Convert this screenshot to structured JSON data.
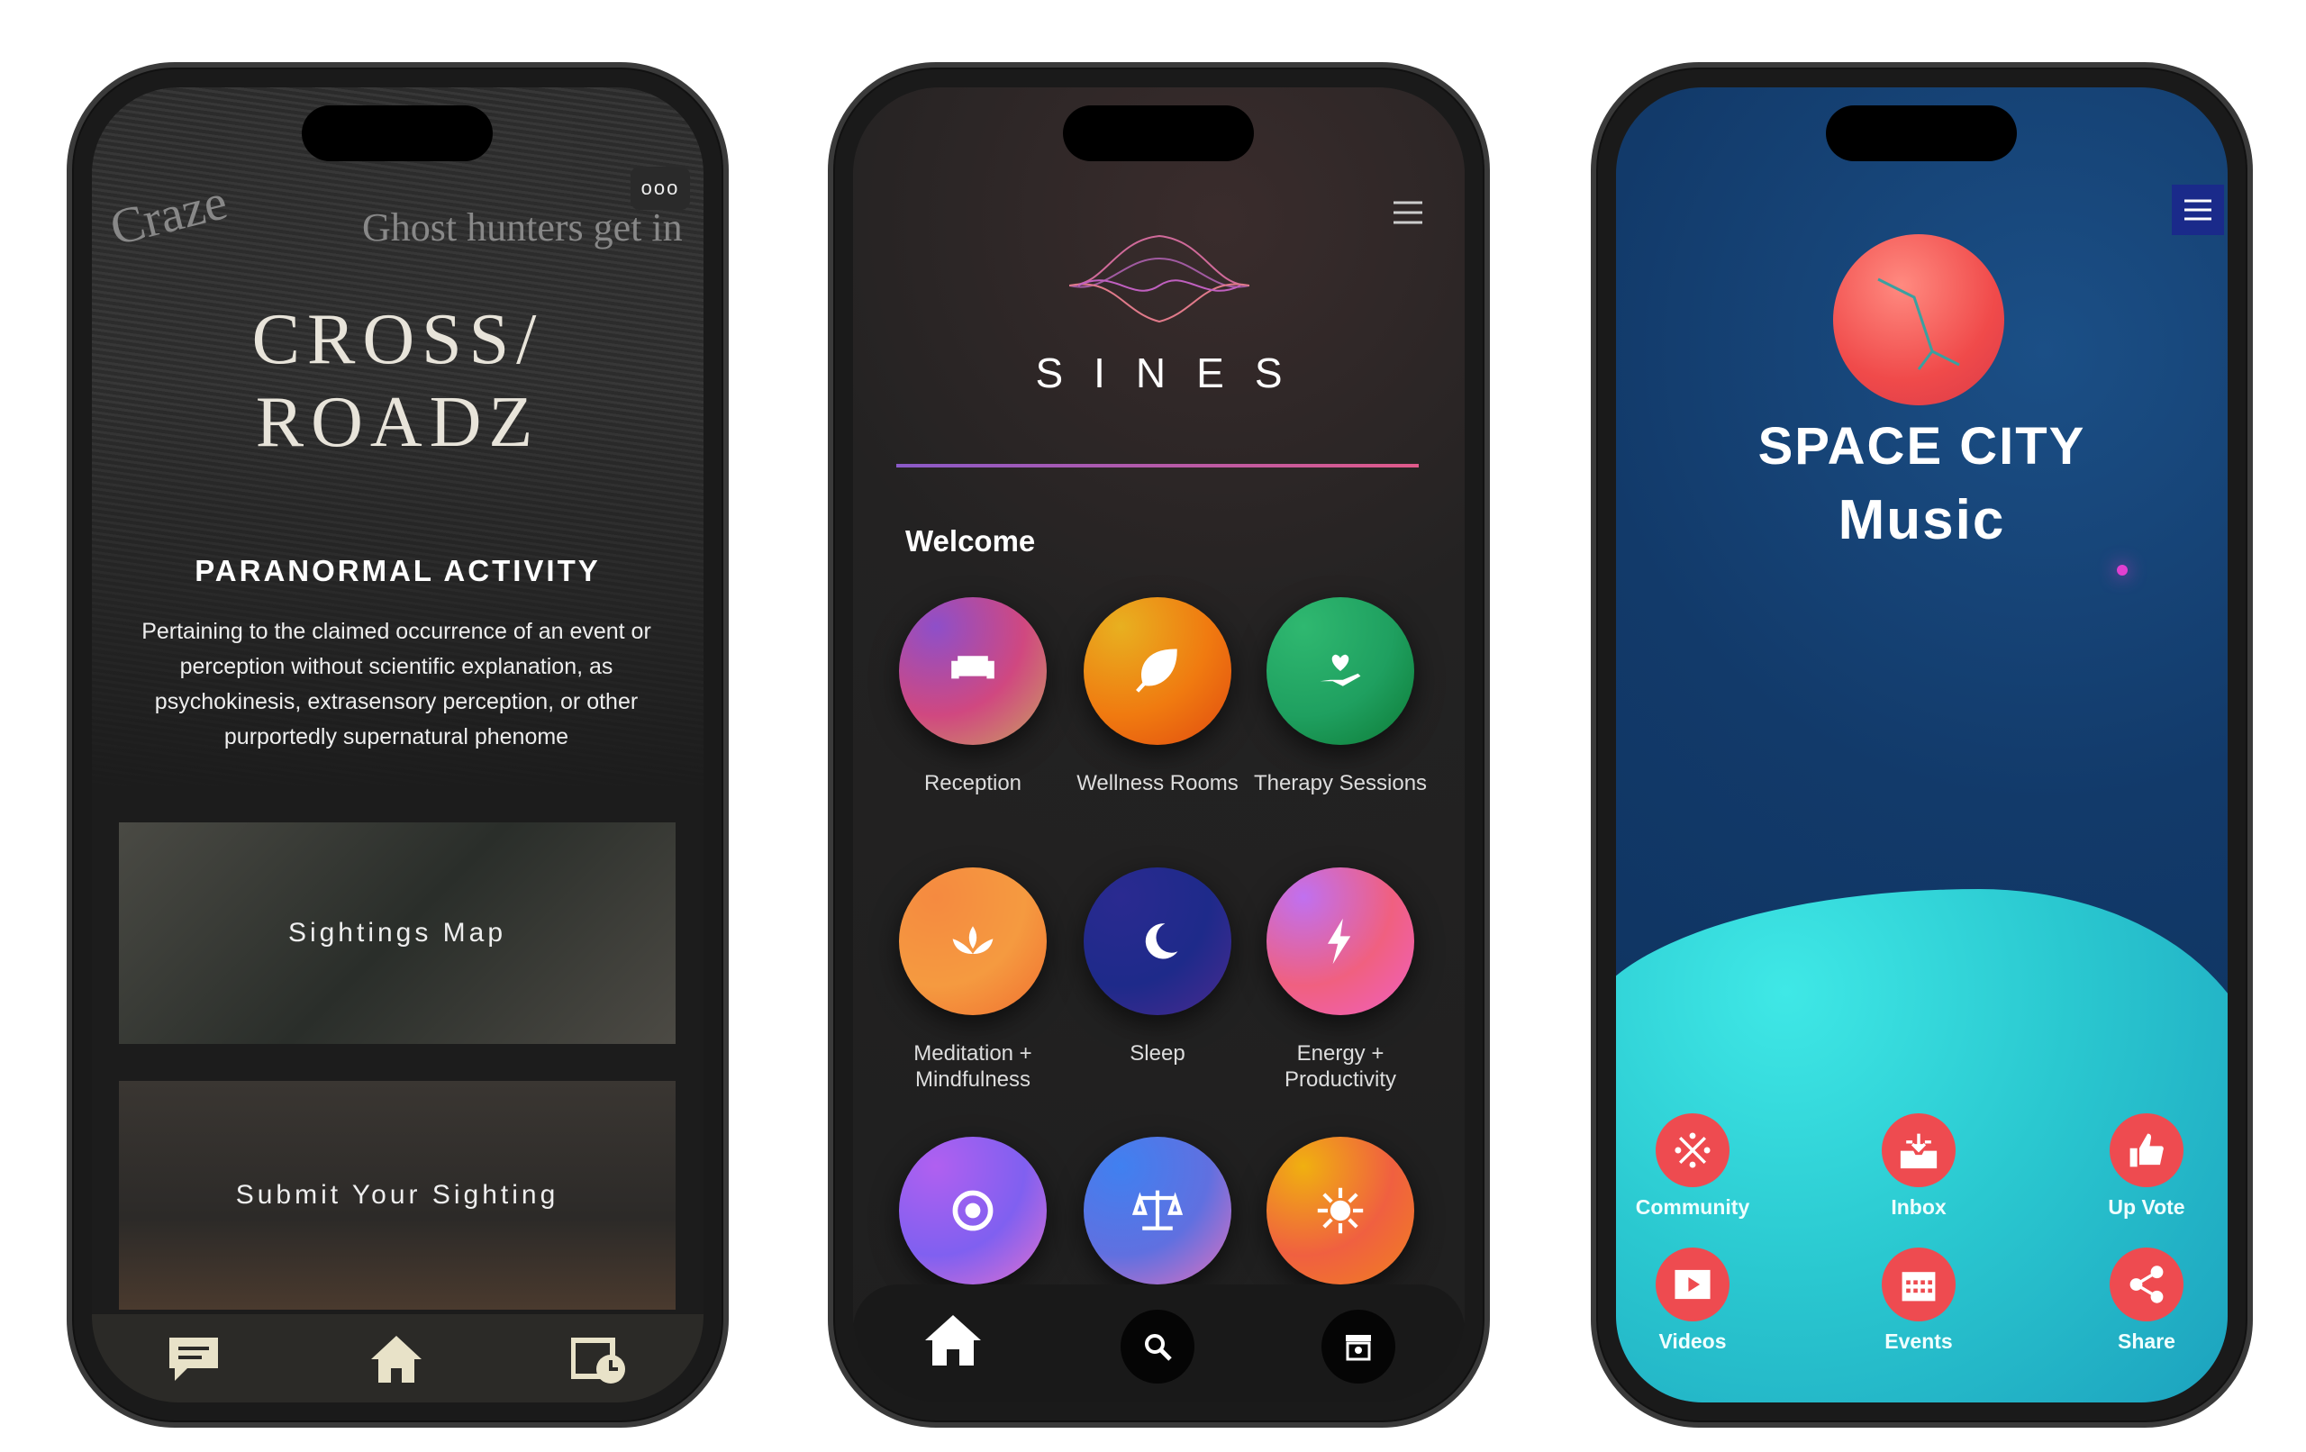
{
  "phones": [
    {
      "app": "crossroadz",
      "title_line1": "CROSS/",
      "title_line2": "ROADZ",
      "more_icon": "more-dots-icon",
      "newspaper_headlines": [
        "Craze",
        "Ghost hunters get in"
      ],
      "heading": "PARANORMAL ACTIVITY",
      "description": "Pertaining to the claimed occurrence of an event or perception without scientific explanation, as psychokinesis, extrasensory perception, or other purportedly  supernatural phenome",
      "cards": [
        {
          "label": "Sightings Map"
        },
        {
          "label": "Submit Your Sighting"
        }
      ],
      "nav": [
        "chat-icon",
        "home-icon",
        "calendar-clock-icon"
      ]
    },
    {
      "app": "sines",
      "brand": "SINES",
      "welcome": "Welcome",
      "menu_icon": "hamburger-icon",
      "tiles": [
        {
          "label": "Reception",
          "icon": "sofa-icon",
          "colors": [
            "#8e4fc9",
            "#c9a060",
            "#d04880"
          ]
        },
        {
          "label": "Wellness Rooms",
          "icon": "leaf-icon",
          "colors": [
            "#e8b020",
            "#e04a10",
            "#f07a10"
          ]
        },
        {
          "label": "Therapy Sessions",
          "icon": "heart-hand-icon",
          "colors": [
            "#2fb870",
            "#0d7a35",
            "#1fa060"
          ]
        },
        {
          "label": "Meditation + Mindfulness",
          "icon": "lotus-icon",
          "colors": [
            "#f58a40",
            "#f07030",
            "#f59a40"
          ]
        },
        {
          "label": "Sleep",
          "icon": "moon-icon",
          "colors": [
            "#2a2a90",
            "#4a2a90",
            "#1e2a8a"
          ]
        },
        {
          "label": "Energy + Productivity",
          "icon": "lightning-icon",
          "colors": [
            "#c070f0",
            "#f060c0",
            "#f06080"
          ]
        },
        {
          "label": "",
          "icon": "target-icon",
          "colors": [
            "#b060f0",
            "#e070d0",
            "#8060f0"
          ]
        },
        {
          "label": "",
          "icon": "scale-icon",
          "colors": [
            "#4080f0",
            "#e070c0",
            "#6070e0"
          ]
        },
        {
          "label": "",
          "icon": "sun-icon",
          "colors": [
            "#f0b010",
            "#f08020",
            "#f06040"
          ]
        }
      ],
      "nav": [
        "home-icon",
        "search-icon",
        "archive-icon"
      ]
    },
    {
      "app": "spacecity",
      "title_line1": "SPACE CITY",
      "title_line2": "Music",
      "menu_icon": "hamburger-icon",
      "buttons": [
        {
          "label": "Community",
          "icon": "community-icon"
        },
        {
          "label": "Inbox",
          "icon": "inbox-icon"
        },
        {
          "label": "Up Vote",
          "icon": "thumbs-up-icon"
        },
        {
          "label": "Videos",
          "icon": "video-icon"
        },
        {
          "label": "Events",
          "icon": "calendar-icon"
        },
        {
          "label": "Share",
          "icon": "share-icon"
        }
      ],
      "accent": "#ee4b50"
    }
  ]
}
